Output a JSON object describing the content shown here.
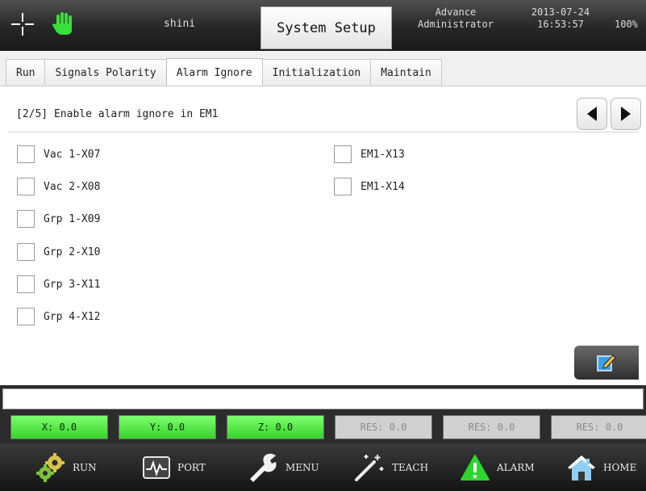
{
  "header": {
    "user": "shini",
    "title": "System Setup",
    "role_line1": "Advance",
    "role_line2": "Administrator",
    "date": "2013-07-24",
    "time": "16:53:57",
    "battery": "100%"
  },
  "tabs": [
    {
      "label": "Run"
    },
    {
      "label": "Signals Polarity"
    },
    {
      "label": "Alarm Ignore",
      "active": true
    },
    {
      "label": "Initialization"
    },
    {
      "label": "Maintain"
    }
  ],
  "page": {
    "heading": "[2/5] Enable alarm ignore in EM1",
    "left_items": [
      {
        "label": "Vac 1-X07",
        "checked": false
      },
      {
        "label": "Vac 2-X08",
        "checked": false
      },
      {
        "label": "Grp 1-X09",
        "checked": false
      },
      {
        "label": "Grp 2-X10",
        "checked": false
      },
      {
        "label": "Grp 3-X11",
        "checked": false
      },
      {
        "label": "Grp 4-X12",
        "checked": false
      }
    ],
    "right_items": [
      {
        "label": "EM1-X13",
        "checked": false
      },
      {
        "label": "EM1-X14",
        "checked": false
      }
    ]
  },
  "message": "",
  "coordinates": [
    {
      "label": "X: 0.0",
      "active": true
    },
    {
      "label": "Y: 0.0",
      "active": true
    },
    {
      "label": "Z: 0.0",
      "active": true
    },
    {
      "label": "RES: 0.0",
      "active": false
    },
    {
      "label": "RES: 0.0",
      "active": false
    },
    {
      "label": "RES: 0.0",
      "active": false
    }
  ],
  "bottom_nav": [
    {
      "label": "RUN",
      "icon": "gears-icon"
    },
    {
      "label": "PORT",
      "icon": "pulse-monitor-icon"
    },
    {
      "label": "MENU",
      "icon": "wrench-icon"
    },
    {
      "label": "TEACH",
      "icon": "magic-wand-icon"
    },
    {
      "label": "ALARM",
      "icon": "warning-icon"
    },
    {
      "label": "HOME",
      "icon": "house-icon"
    }
  ],
  "colors": {
    "coord_active": "#37d22b",
    "coord_inactive": "#d0d0d0",
    "alarm_green": "#2fd52f"
  }
}
